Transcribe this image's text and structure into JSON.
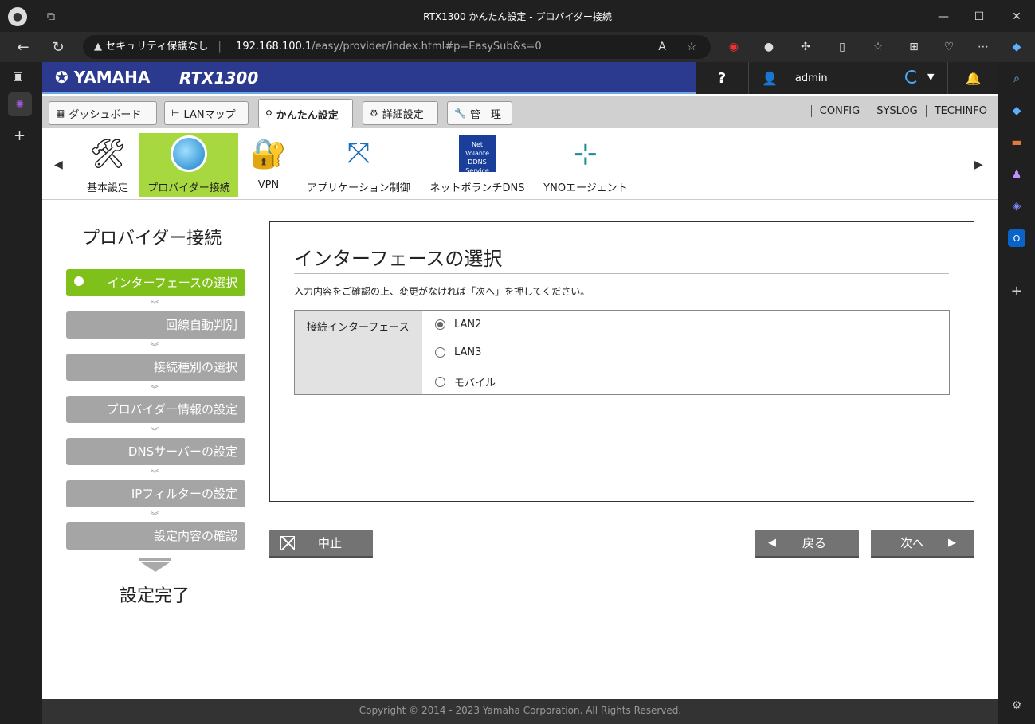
{
  "browser": {
    "window_title": "RTX1300 かんたん設定 - プロバイダー接続",
    "security_label": "セキュリティ保護なし",
    "url_host": "192.168.100.1",
    "url_path": "/easy/provider/index.html#p=EasySub&s=0"
  },
  "header": {
    "logo": "YAMAHA",
    "model": "RTX1300",
    "help": "?",
    "user": "admin"
  },
  "tabs": [
    {
      "label": "ダッシュボード",
      "icon": "dashboard-icon"
    },
    {
      "label": "LANマップ",
      "icon": "lanmap-icon"
    },
    {
      "label": "かんたん設定",
      "icon": "easy-setup-icon",
      "active": true
    },
    {
      "label": "詳細設定",
      "icon": "gear-icon"
    },
    {
      "label": "管　理",
      "icon": "wrench-icon"
    }
  ],
  "top_links": [
    "CONFIG",
    "SYSLOG",
    "TECHINFO"
  ],
  "menu_items": [
    {
      "label": "基本設定"
    },
    {
      "label": "プロバイダー接続",
      "active": true
    },
    {
      "label": "VPN"
    },
    {
      "label": "アプリケーション制御"
    },
    {
      "label": "ネットボランチDNS",
      "badge_top": "Net Volante",
      "badge_bottom": "DDNS Service"
    },
    {
      "label": "YNOエージェント"
    }
  ],
  "steps": {
    "title": "プロバイダー接続",
    "items": [
      "インターフェースの選択",
      "回線自動判別",
      "接続種別の選択",
      "プロバイダー情報の設定",
      "DNSサーバーの設定",
      "IPフィルターの設定",
      "設定内容の確認"
    ],
    "active_index": 0,
    "done": "設定完了"
  },
  "panel": {
    "title": "インターフェースの選択",
    "description": "入力内容をご確認の上、変更がなければ「次へ」を押してください。",
    "field_label": "接続インターフェース",
    "options": [
      "LAN2",
      "LAN3",
      "モバイル"
    ],
    "selected": "LAN2"
  },
  "buttons": {
    "cancel": "中止",
    "back": "戻る",
    "next": "次へ"
  },
  "footer": "Copyright © 2014 - 2023 Yamaha Corporation. All Rights Reserved."
}
